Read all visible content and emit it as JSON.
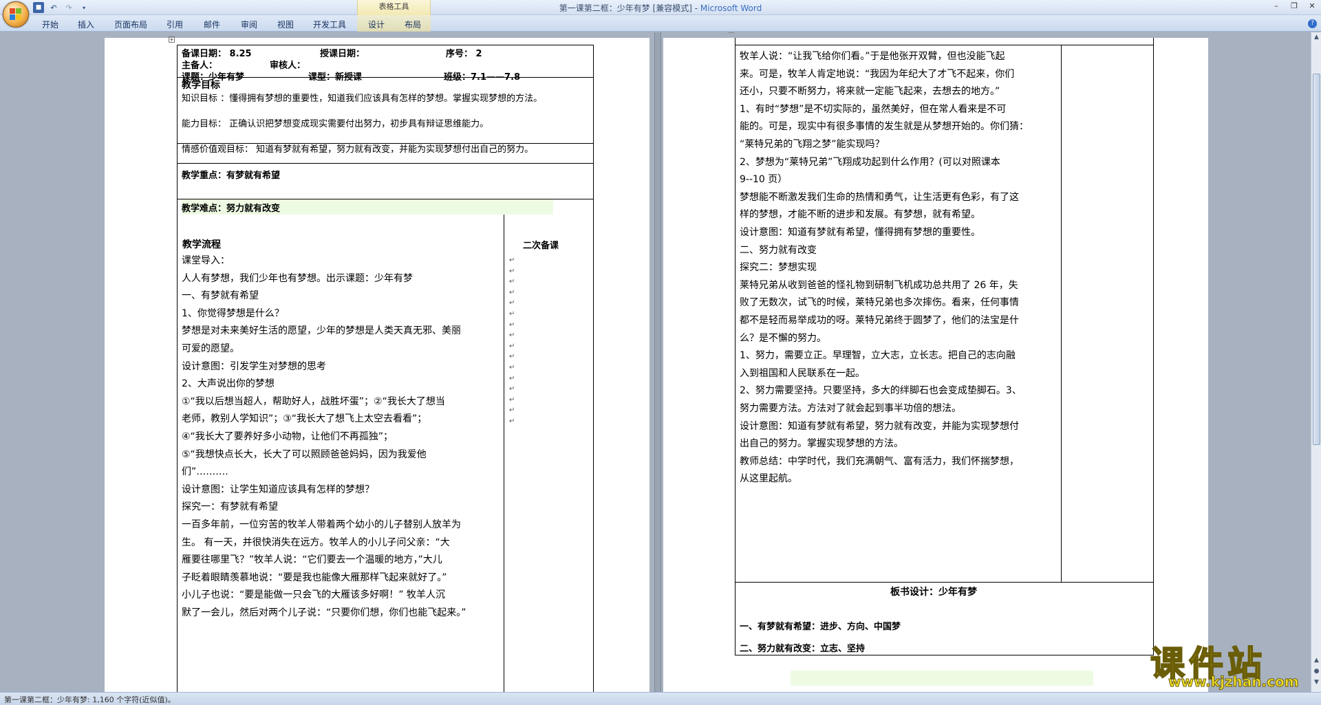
{
  "window": {
    "title": "第一课第二框：少年有梦 [兼容模式] - ",
    "app_name": "Microsoft Word",
    "context_tools": "表格工具"
  },
  "ribbon": {
    "tabs": [
      "开始",
      "插入",
      "页面布局",
      "引用",
      "邮件",
      "审阅",
      "视图",
      "开发工具",
      "设计",
      "布局"
    ]
  },
  "page1": {
    "header": {
      "prep_date": "备课日期：  8.25",
      "teach_date": "授课日期：",
      "seq": "序号：  2",
      "preparer": "主备人：",
      "reviewer": "审核人：",
      "topic": "课题：少年有梦",
      "lesson_type": "课型：新授课",
      "class": "班级：7.1——7.8"
    },
    "objectives_title": "教学目标",
    "objectives": [
      "知识目标 ：懂得拥有梦想的重要性，知道我们应该具有怎样的梦想。掌握实现梦想的方法。",
      "能力目标：  正确认识把梦想变成现实需要付出努力，初步具有辩证思维能力。",
      "情感价值观目标：  知道有梦就有希望，努力就有改变，并能为实现梦想付出自己的努力。"
    ],
    "key_point": "教学重点：有梦就有希望",
    "difficult_point": "教学难点：努力就有改变",
    "flow_title": "教学流程",
    "second_prep_title": "二次备课",
    "flow": [
      "课堂导入：",
      "人人有梦想，我们少年也有梦想。出示课题：少年有梦",
      "一、有梦就有希望",
      "1、你觉得梦想是什么？",
      "梦想是对未来美好生活的愿望，少年的梦想是人类天真无邪、美丽",
      "可爱的愿望。",
      "设计意图：引发学生对梦想的思考",
      "2、大声说出你的梦想",
      "①“我以后想当超人，帮助好人，战胜坏蛋”；②“我长大了想当",
      "老师，教别人学知识”；③“我长大了想飞上太空去看看”；",
      "④“我长大了要养好多小动物，让他们不再孤独”；",
      "⑤“我想快点长大，长大了可以照顾爸爸妈妈，因为我爱他",
      "们”……….",
      "设计意图：让学生知道应该具有怎样的梦想？",
      "探究一：有梦就有希望",
      "一百多年前，一位穷苦的牧羊人带着两个幼小的儿子替别人放羊为",
      "生。 有一天，并很快消失在远方。牧羊人的小儿子问父亲：“大",
      "雁要往哪里飞？”牧羊人说：“它们要去一个温暖的地方，”大儿",
      "子眨着眼睛羡慕地说：“要是我也能像大雁那样飞起来就好了。”",
      "小儿子也说：“要是能做一只会飞的大雁该多好啊！” 牧羊人沉",
      "默了一会儿，然后对两个儿子说：“只要你们想，你们也能飞起来。”"
    ]
  },
  "page2": {
    "flow": [
      "牧羊人说：“让我飞给你们看。”于是他张开双臂，但也没能飞起",
      "来。可是，牧羊人肯定地说：“我因为年纪大了才飞不起来，你们",
      "还小，只要不断努力，将来就一定能飞起来，去想去的地方。”",
      "1、有时“梦想”是不切实际的，虽然美好，但在常人看来是不可",
      "能的。可是，现实中有很多事情的发生就是从梦想开始的。你们猜：",
      "“莱特兄弟的飞翔之梦”能实现吗？",
      "2、梦想为“莱特兄弟”飞翔成功起到什么作用？(可以对照课本",
      "9--10 页）",
      "梦想能不断激发我们生命的热情和勇气，让生活更有色彩，有了这",
      "样的梦想，才能不断的进步和发展。有梦想，就有希望。",
      "设计意图：知道有梦就有希望，懂得拥有梦想的重要性。",
      "二、努力就有改变",
      "探究二：梦想实现",
      "莱特兄弟从收到爸爸的怪礼物到研制飞机成功总共用了 26 年，失",
      "败了无数次，试飞的时候，莱特兄弟也多次摔伤。看来，任何事情",
      "都不是轻而易举成功的呀。莱特兄弟终于圆梦了，他们的法宝是什",
      "么？是不懈的努力。",
      "1、努力，需要立正。早理智，立大志，立长志。把自己的志向融",
      "入到祖国和人民联系在一起。",
      "2、努力需要坚持。只要坚持，多大的绊脚石也会变成垫脚石。3、",
      "努力需要方法。方法对了就会起到事半功倍的想法。",
      "设计意图：知道有梦就有希望，努力就有改变，并能为实现梦想付",
      "出自己的努力。掌握实现梦想的方法。",
      "教师总结：中学时代，我们充满朝气、富有活力，我们怀揣梦想，",
      "从这里起航。"
    ],
    "board_title": "板书设计：少年有梦",
    "board_lines": [
      "一、有梦就有希望：进步、方向、中国梦",
      "二、努力就有改变：立志、坚持"
    ]
  },
  "status_bar": "第一课第二框：少年有梦: 1,160 个字符(近似值)。",
  "watermark": {
    "main": "课件站",
    "url": "www.kjzhan.com"
  },
  "paragraph_mark": "↵"
}
